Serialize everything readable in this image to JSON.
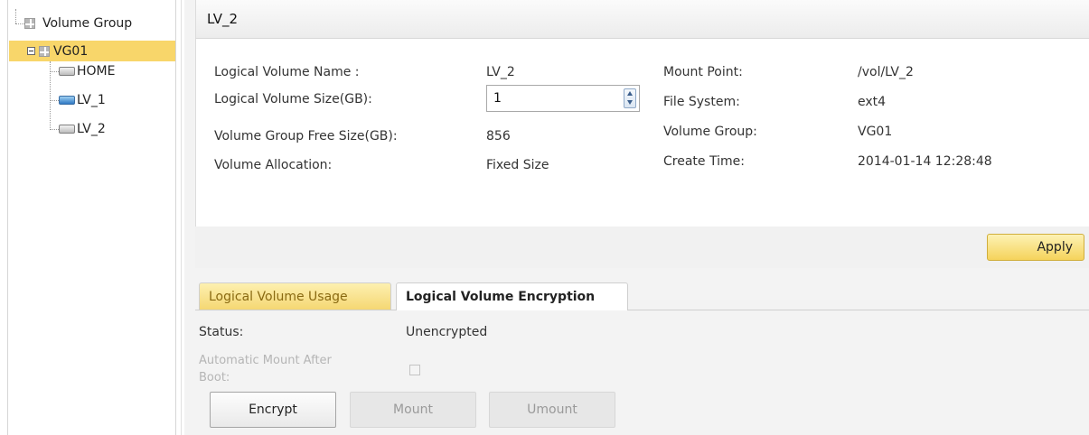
{
  "tree": {
    "root_label": "Volume Group",
    "group_label": "VG01",
    "volumes": [
      {
        "label": "HOME",
        "icon": "hdd-icon"
      },
      {
        "label": "LV_1",
        "icon": "hdd-blue-icon"
      },
      {
        "label": "LV_2",
        "icon": "hdd-icon"
      }
    ]
  },
  "header": {
    "title": "LV_2"
  },
  "form": {
    "lv_name_label": "Logical Volume Name :",
    "lv_name_value": "LV_2",
    "lv_size_label": "Logical Volume Size(GB):",
    "lv_size_value": "1",
    "vg_free_label": "Volume Group Free Size(GB):",
    "vg_free_value": "856",
    "alloc_label": "Volume Allocation:",
    "alloc_value": "Fixed Size",
    "mount_point_label": "Mount Point:",
    "mount_point_value": "/vol/LV_2",
    "fs_label": "File System:",
    "fs_value": "ext4",
    "vg_label": "Volume Group:",
    "vg_value": "VG01",
    "create_time_label": "Create Time:",
    "create_time_value": "2014-01-14 12:28:48"
  },
  "apply_label": "Apply",
  "tabs": [
    {
      "label": "Logical Volume Usage"
    },
    {
      "label": "Logical Volume Encryption"
    }
  ],
  "encryption": {
    "status_label": "Status:",
    "status_value": "Unencrypted",
    "automount_label_line1": "Automatic Mount After",
    "automount_label_line2": "Boot:",
    "automount_checked": false,
    "encrypt_label": "Encrypt",
    "mount_label": "Mount",
    "umount_label": "Umount"
  },
  "colors": {
    "selection": "#f8d66a",
    "tab_active": "#f5d773",
    "apply": "#f5d35b"
  }
}
